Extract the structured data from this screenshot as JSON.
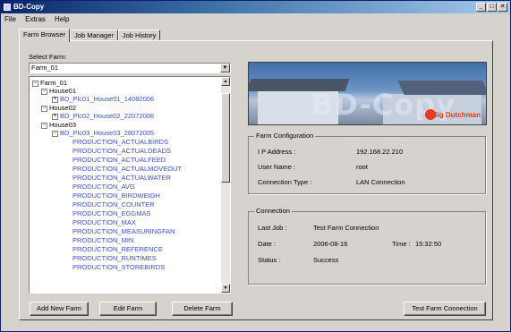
{
  "window": {
    "title": "BD-Copy"
  },
  "menu": [
    "File",
    "Extras",
    "Help"
  ],
  "tabs": [
    "Farm Browser",
    "Job Manager",
    "Job History"
  ],
  "select_farm": {
    "label": "Select Farm:",
    "value": "Farm_01"
  },
  "tree": {
    "root": "Farm_01",
    "house1": "House01",
    "house1_child": "BD_Plc01_House01_14082006",
    "house2": "House02",
    "house2_child": "BD_Plc02_House02_22072006",
    "house3": "House03",
    "house3_child": "BD_Plc03_House03_28072005",
    "tables": [
      "PRODUCTION_ACTUALBIRDS",
      "PRODUCTION_ACTUALDEADS",
      "PRODUCTION_ACTUALFEED",
      "PRODUCTION_ACTUALMOVEOUT",
      "PRODUCTION_ACTUALWATER",
      "PRODUCTION_AVG",
      "PRODUCTION_BIRDWEIGH",
      "PRODUCTION_COUNTER",
      "PRODUCTION_EGGMAS",
      "PRODUCTION_MAX",
      "PRODUCTION_MEASURINGFAN",
      "PRODUCTION_MIN",
      "PRODUCTION_REFERENCE",
      "PRODUCTION_RUNTIMES",
      "PRODUCTION_STOREBIRDS"
    ]
  },
  "buttons": {
    "add": "Add New Farm",
    "edit": "Edit Farm",
    "delete": "Delete Farm",
    "test": "Test Farm Connection"
  },
  "banner": {
    "logo_text": "Big Dutchman"
  },
  "farm_config": {
    "title": "Farm Configuration",
    "ip_label": "I P Address :",
    "ip_value": "192.168.22.210",
    "user_label": "User Name :",
    "user_value": "root",
    "conn_label": "Connection Type :",
    "conn_value": "LAN Connection"
  },
  "connection": {
    "title": "Connection",
    "lastjob_label": "Last Job :",
    "lastjob_value": "Test Farm Connection",
    "date_label": "Date :",
    "date_value": "2006-08-16",
    "time_label": "Time :",
    "time_value": "15:32:50",
    "status_label": "Status :",
    "status_value": "Success"
  },
  "colors": {
    "tree_leaf": "#3b4fd8",
    "title_bar": "#0a246a",
    "logo_red": "#e63b1c"
  }
}
